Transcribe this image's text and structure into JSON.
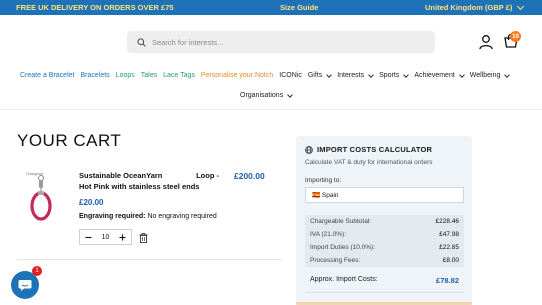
{
  "topbar": {
    "promo": "FREE UK DELIVERY ON ORDERS OVER £75",
    "size_guide": "Size Guide",
    "region": "United Kingdom (GBP £)"
  },
  "search": {
    "placeholder": "Search for interests..."
  },
  "cart": {
    "badge_count": "10"
  },
  "nav": {
    "items": [
      {
        "label": "Create a Bracelet",
        "color": "#1e73b8"
      },
      {
        "label": "Bracelets",
        "color": "#1e73b8"
      },
      {
        "label": "Loops",
        "color": "#2a9a6a"
      },
      {
        "label": "Tales",
        "color": "#2a9a6a"
      },
      {
        "label": "Lace Tags",
        "color": "#2a9a6a"
      },
      {
        "label": "Personalise your Notch",
        "color": "#e58a2a"
      },
      {
        "label": "ICONic",
        "color": "#222222"
      },
      {
        "label": "Gifts",
        "color": "#222222"
      },
      {
        "label": "Interests",
        "color": "#222222"
      },
      {
        "label": "Sports",
        "color": "#222222"
      },
      {
        "label": "Achievement",
        "color": "#222222"
      },
      {
        "label": "Wellbeing",
        "color": "#222222"
      }
    ],
    "row2": "Organisations"
  },
  "page": {
    "title": "YOUR CART"
  },
  "product": {
    "name_line1": "Sustainable OceanYarn",
    "name_loop": "Loop -",
    "name_line2": "Hot Pink with stainless steel ends",
    "price": "£200.00",
    "unit_price": "£20.00",
    "engraving_label": "Engraving required:",
    "engraving_value": "No engraving required",
    "quantity": "10",
    "image_brand": "Changeset"
  },
  "chat": {
    "badge": "1"
  },
  "calculator": {
    "title": "IMPORT COSTS CALCULATOR",
    "subtitle": "Calculate VAT & duty for international orders",
    "importing_label": "Importing to:",
    "country": "🇪🇸 Spain",
    "rows": [
      {
        "label": "Chargeable Subtotal:",
        "value": "£228.46"
      },
      {
        "label": "IVA (21.0%):",
        "value": "£47.98"
      },
      {
        "label": "Import Duties (10.0%):",
        "value": "£22.85"
      },
      {
        "label": "Processing Fees:",
        "value": "£8.00"
      }
    ],
    "total_label": "Approx. Import Costs:",
    "total_value": "£78.82"
  }
}
